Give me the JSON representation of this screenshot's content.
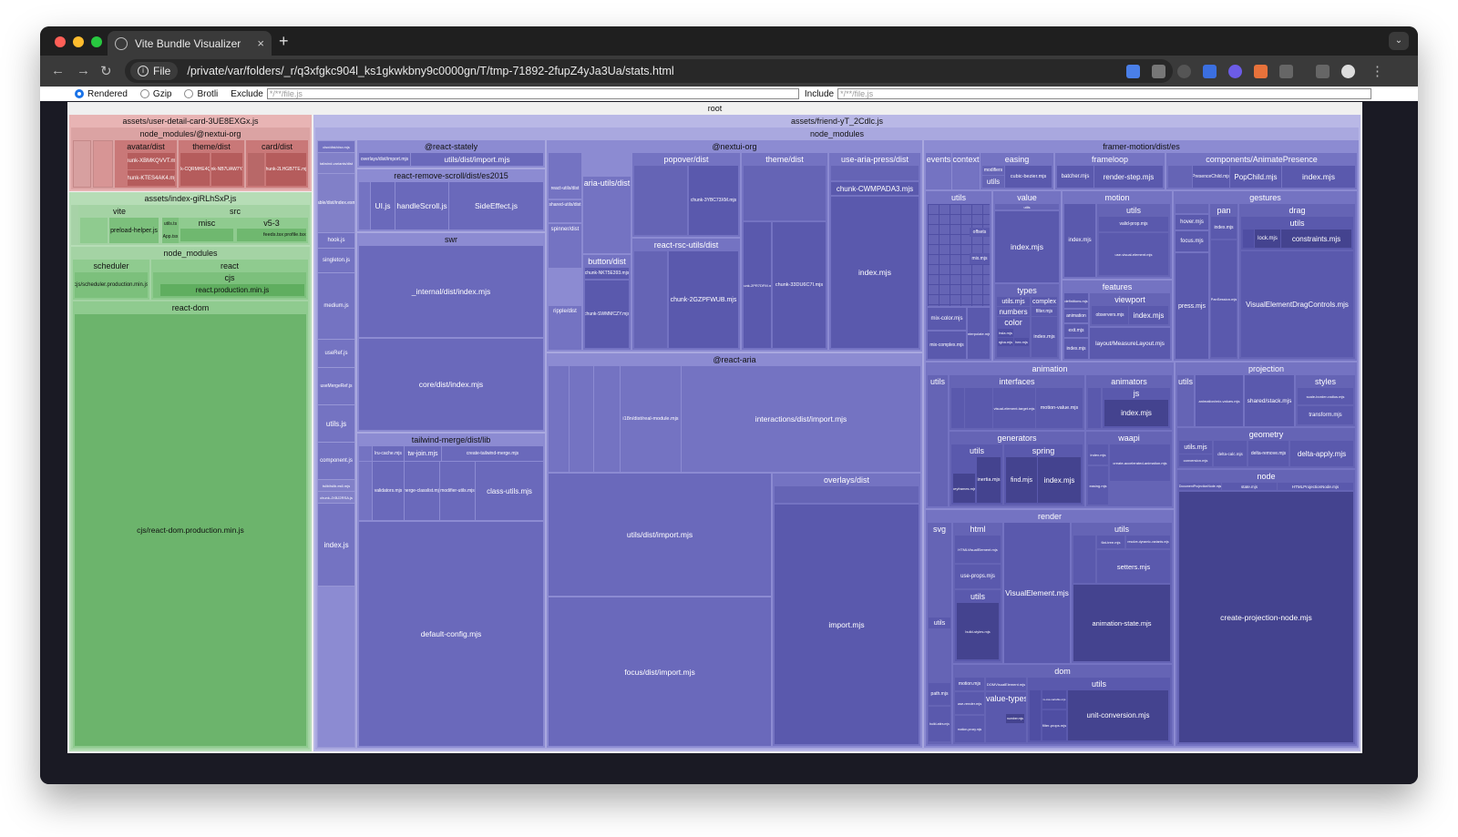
{
  "browser": {
    "tab_title": "Vite Bundle Visualizer",
    "close_glyph": "×",
    "new_tab_glyph": "+",
    "chip_label": "File",
    "url": "/private/var/folders/_r/q3xfgkc904l_ks1gkwkbny9c0000gn/T/tmp-71892-2fupZ4yJa3Ua/stats.html",
    "back_glyph": "←",
    "forward_glyph": "→",
    "reload_glyph": "↻",
    "star_glyph": "☆",
    "menu_glyph": "⋮",
    "tab_menu_glyph": "⌄"
  },
  "controls": {
    "rendered": "Rendered",
    "gzip": "Gzip",
    "brotli": "Brotli",
    "exclude_label": "Exclude",
    "exclude_value": "*/**/file.js",
    "include_label": "Include",
    "include_value": "*/**/file.js"
  },
  "treemap": {
    "root": "root",
    "user_detail": {
      "asset": "assets/user-detail-card-3UE8EXGx.js",
      "nm": "node_modules/@nextui-org",
      "avatar": "avatar/dist",
      "theme": "theme/dist",
      "card": "card/dist",
      "chunk1": "chunk-XBMKQVVT.mjs",
      "chunk2": "chunk-KTES4AK4.mjs",
      "chunk3": "chunk-CQRMHE4Q.mjs",
      "chunk4": "chunk-NB7UAW7Y.mjs",
      "chunk5": "chunk-2LHGB7TE.mjs"
    },
    "index": {
      "asset": "assets/index-giRLhSxP.js",
      "vite": "vite",
      "src": "src",
      "misc": "misc",
      "v53": "v5-3",
      "preload": "preload-helper.js",
      "utils": "utils.ts",
      "app": "App.tsx",
      "feeds": "feeds.tsx",
      "profile": "profile.tsx",
      "nm": "node_modules",
      "scheduler": "scheduler",
      "scheduler_file": "cjs/scheduler.production.min.js",
      "react": "react",
      "cjs": "cjs",
      "react_prod": "react.production.min.js",
      "react_dom": "react-dom",
      "react_dom_file": "cjs/react-dom.production.min.js"
    },
    "friend": {
      "asset": "assets/friend-yT_2Cdlc.js",
      "nm": "node_modules",
      "left_col": {
        "a": "clsx/dist/clsx.mjs",
        "b": "tailwind-variants/dist",
        "c": "tabbable/dist/index.esm.mjs",
        "d": "tslib/tslib.es6.mjs",
        "hook": "hook.js",
        "singleton": "singleton.js",
        "medium": "medium.js",
        "useRef": "useRef.js",
        "useMergeRef": "useMergeRef.js",
        "utils": "utils.js",
        "component": "component.js",
        "chunk": "chunk-JXBJ2RSA.js",
        "index": "index.js"
      },
      "stately": "@react-stately",
      "stately_overlays": "overlays/dist/import.mjs",
      "stately_utils": "utils/dist/import.mjs",
      "rrs": "react-remove-scroll/dist/es2015",
      "ui": "UI.js",
      "handle": "handleScroll.js",
      "side": "SideEffect.js",
      "swr": "swr",
      "swr_internal": "_internal/dist/index.mjs",
      "swr_core": "core/dist/index.mjs",
      "tw": "tailwind-merge/dist/lib",
      "lru": "lru-cache.mjs",
      "twjoin": "tw-join.mjs",
      "create_tw": "create-tailwind-merge.mjs",
      "validators": "validators.mjs",
      "merge_classlist": "merge-classlist.mjs",
      "modifier_utils": "modifier-utils.mjs",
      "class_utils": "class-utils.mjs",
      "default_config": "default-config.mjs",
      "nextui": "@nextui-org",
      "react_utils": "react-utils/dist",
      "shared_utils": "shared-utils/dist",
      "spinner": "spinner/dist",
      "ripple": "ripple/dist",
      "aria_utils": "aria-utils/dist",
      "button": "button/dist",
      "chunk_nkt": "chunk-NKT5E393.mjs",
      "chunk_swmm": "chunk-SWMMCZY.mjs",
      "popover": "popover/dist",
      "chunk_3ybc": "chunk-3YBC73XM.mjs",
      "rsc": "react-rsc-utils/dist",
      "chunk_2gzp": "chunk-2GZPFWUB.mjs",
      "theme": "theme/dist",
      "chunk_33du": "chunk-33DU6C7I.mjs",
      "chunk_2pr7": "chunk-2PR7DFM.mjs",
      "use_aria_press": "use-aria-press/dist",
      "chunk_cwmp": "chunk-CWMPADA3.mjs",
      "nextui_index": "index.mjs",
      "react_aria": "@react-aria",
      "i18n": "i18n/dist/real-module.mjs",
      "interactions": "interactions/dist/import.mjs",
      "aria_utils_import": "utils/dist/import.mjs",
      "focus": "focus/dist/import.mjs",
      "overlays": "overlays/dist",
      "overlays_import": "import.mjs",
      "fm": "framer-motion/dist/es",
      "events": "events",
      "context": "context",
      "easing": "easing",
      "modifiers": "modifiers",
      "easing_utils": "utils",
      "cubic": "cubic-bezier.mjs",
      "frameloop": "frameloop",
      "batcher": "batcher.mjs",
      "render_step": "render-step.mjs",
      "anim_presence": "components/AnimatePresence",
      "presence_child": "PresenceChild.mjs",
      "popchild": "PopChild.mjs",
      "ap_index": "index.mjs",
      "fm_utils": "utils",
      "offsets": "offsets",
      "mix": "mix.mjs",
      "mix_color": "mix-color.mjs",
      "mix_complex": "mix-complex.mjs",
      "value": "value",
      "value_utils": "utils",
      "value_index": "index.mjs",
      "types": "types",
      "types_utils": "utils.mjs",
      "numbers": "numbers",
      "complex": "complex",
      "filter": "filter.mjs",
      "color": "color",
      "types_index": "index.mjs",
      "interpolate": "interpolate.mjs",
      "hsla": "hsla.mjs",
      "rgba": "rgba.mjs",
      "hex": "hex.mjs",
      "motion": "motion",
      "motion_utils": "utils",
      "motion_index": "index.mjs",
      "valid_prop": "valid-prop.mjs",
      "use_visual": "use-visual-element.mjs",
      "features": "features",
      "viewport": "viewport",
      "definitions": "definitions.mjs",
      "observers": "observers.mjs",
      "viewport_index": "index.mjs",
      "animation_f": "animation",
      "exit": "exit.mjs",
      "features_index": "index.mjs",
      "layout_measure": "layout/MeasureLayout.mjs",
      "gestures": "gestures",
      "hover": "hover.mjs",
      "focus_mjs": "focus.mjs",
      "press": "press.mjs",
      "pan": "pan",
      "pan_index": "index.mjs",
      "pan_session": "PanSession.mjs",
      "drag": "drag",
      "drag_utils": "utils",
      "lock": "lock.mjs",
      "constraints": "constraints.mjs",
      "vedc": "VisualElementDragControls.mjs",
      "animation": "animation",
      "anim_utils": "utils",
      "interfaces": "interfaces",
      "motion_value": "motion-value.mjs",
      "visual_el_target": "visual-element-target.mjs",
      "animators": "animators",
      "js": "js",
      "js_index": "index.mjs",
      "generators": "generators",
      "gen_utils": "utils",
      "spring": "spring",
      "inertia": "inertia.mjs",
      "find": "find.mjs",
      "spring_index": "index.mjs",
      "waapi": "waapi",
      "create_accel": "create-accelerated-animation.mjs",
      "waapi_index": "index.mjs",
      "easing_mjs": "easing.mjs",
      "keyframes": "keyframes.mjs",
      "projection": "projection",
      "proj_utils": "utils",
      "anim_mix": "animation/mix-values.mjs",
      "shared_stack": "shared/stack.mjs",
      "styles": "styles",
      "scale_border": "scale-border-radius.mjs",
      "transform": "transform.mjs",
      "geometry": "geometry",
      "geo_utils": "utils.mjs",
      "delta_calc": "delta-calc.mjs",
      "delta_remove": "delta-remove.mjs",
      "delta_apply": "delta-apply.mjs",
      "conversion": "conversion.mjs",
      "node": "node",
      "doc_proj": "DocumentProjectionNode.mjs",
      "state": "state.mjs",
      "html_proj": "HTMLProjectionNode.mjs",
      "create_proj": "create-projection-node.mjs",
      "render": "render",
      "svg": "svg",
      "html": "html",
      "html_ve": "HTMLVisualElement.mjs",
      "use_props": "use-props.mjs",
      "html_utils": "utils",
      "build_styles": "build-styles.mjs",
      "svg_utils": "utils",
      "path": "path.mjs",
      "build_attrs": "build-attrs.mjs",
      "visual_element": "VisualElement.mjs",
      "render_utils": "utils",
      "flat_tree": "flat-tree.mjs",
      "resolve_dyn": "resolve-dynamic-variants.mjs",
      "setters": "setters.mjs",
      "anim_state": "animation-state.mjs",
      "dom": "dom",
      "dom_motion": "motion.mjs",
      "dom_ve": "DOMVisualElement.mjs",
      "use_render": "use-render.mjs",
      "motion_proxy": "motion-proxy.mjs",
      "value_types": "value-types",
      "number": "number.mjs",
      "dom_utils": "utils",
      "filter_props": "filter-props.mjs",
      "is_css_var": "is-css-variable.mjs",
      "unit_conv": "unit-conversion.mjs"
    }
  },
  "colors": {
    "red_light": "#e8b4b4",
    "red_mid": "#d79595",
    "red_dark": "#b55c5c",
    "green_light": "#b6ddb6",
    "green_mid": "#8fcb8f",
    "green_dark": "#5fae5f",
    "purple_light": "#b9b8e6",
    "purple_mid": "#8c8bd2",
    "purple_dark": "#5a59ad",
    "purple_deep": "#44438f"
  }
}
